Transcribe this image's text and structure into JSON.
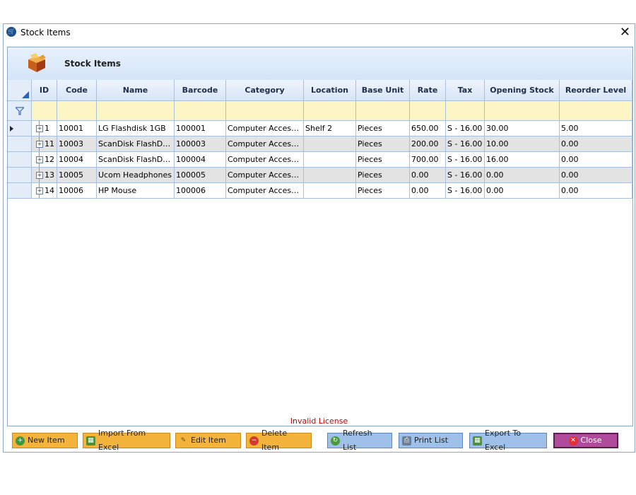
{
  "window": {
    "title": "Stock Items",
    "close_glyph": "✕"
  },
  "header": {
    "title": "Stock Items"
  },
  "grid": {
    "columns": [
      "ID",
      "Code",
      "Name",
      "Barcode",
      "Category",
      "Location",
      "Base Unit",
      "Rate",
      "Tax",
      "Opening Stock",
      "Reorder Level"
    ],
    "rows": [
      {
        "id": "1",
        "code": "10001",
        "name": "LG Flashdisk 1GB",
        "barcode": "100001",
        "category": "Computer Accesso...",
        "location": "Shelf 2",
        "unit": "Pieces",
        "rate": "650.00",
        "tax": "S - 16.00",
        "opening": "30.00",
        "reorder": "5.00"
      },
      {
        "id": "11",
        "code": "10003",
        "name": "ScanDisk FlashDisk...",
        "barcode": "100003",
        "category": "Computer Accesso...",
        "location": "",
        "unit": "Pieces",
        "rate": "200.00",
        "tax": "S - 16.00",
        "opening": "10.00",
        "reorder": "0.00"
      },
      {
        "id": "12",
        "code": "10004",
        "name": "ScanDisk FlashDisk...",
        "barcode": "100004",
        "category": "Computer Accesso...",
        "location": "",
        "unit": "Pieces",
        "rate": "700.00",
        "tax": "S - 16.00",
        "opening": "16.00",
        "reorder": "0.00"
      },
      {
        "id": "13",
        "code": "10005",
        "name": "Ucom Headphones",
        "barcode": "100005",
        "category": "Computer Accesso...",
        "location": "",
        "unit": "Pieces",
        "rate": "0.00",
        "tax": "S - 16.00",
        "opening": "0.00",
        "reorder": "0.00"
      },
      {
        "id": "14",
        "code": "10006",
        "name": "HP Mouse",
        "barcode": "100006",
        "category": "Computer Accesso...",
        "location": "",
        "unit": "Pieces",
        "rate": "0.00",
        "tax": "S - 16.00",
        "opening": "0.00",
        "reorder": "0.00"
      }
    ]
  },
  "status": {
    "license": "Invalid License"
  },
  "buttons": {
    "new_item": "New Item",
    "import_excel": "Import From Excel",
    "edit_item": "Edit Item",
    "delete_item": "Delete Item",
    "refresh_list": "Refresh List",
    "print_list": "Print List",
    "export_excel": "Export To Excel",
    "close": "Close"
  },
  "colors": {
    "orange_button": "#f4b43c",
    "blue_button": "#9fc0e8",
    "close_button": "#b04a9a",
    "license_text": "#cc0000",
    "filter_row": "#fdf6c4"
  },
  "icons": {
    "title": "cart-icon",
    "header": "box-icon",
    "filter": "funnel-icon"
  }
}
